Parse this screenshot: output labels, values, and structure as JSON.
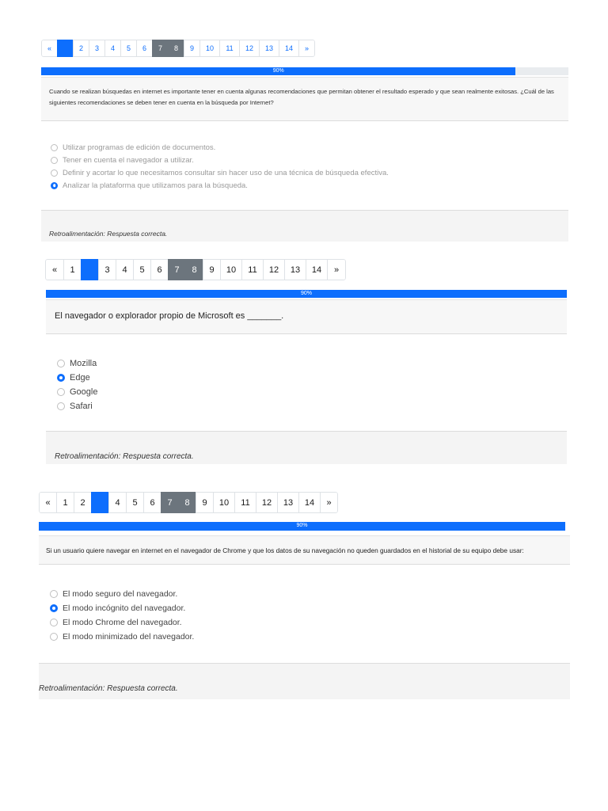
{
  "colors": {
    "accent": "#0d6efd",
    "answered": "#6c757d"
  },
  "blocks": [
    {
      "pagination": [
        "«",
        "",
        "2",
        "3",
        "4",
        "5",
        "6",
        "7",
        "8",
        "9",
        "10",
        "11",
        "12",
        "13",
        "14",
        "»"
      ],
      "progress": {
        "label": "90%",
        "value": 90
      },
      "question": "Cuando se realizan búsquedas en internet es importante tener en cuenta algunas recomendaciones que permitan obtener el resultado esperado y que sean realmente exitosas. ¿Cuál de las siguientes recomendaciones se deben tener en cuenta en la búsqueda por Internet?",
      "options": [
        "Utilizar programas de edición de documentos.",
        "Tener en cuenta el navegador a utilizar.",
        "Definir y acortar lo que necesitamos consultar sin hacer uso de una técnica de búsqueda efectiva.",
        "Analizar la plataforma que utilizamos para la búsqueda."
      ],
      "selected_option": 4,
      "feedback": "Retroalimentación: Respuesta correcta."
    },
    {
      "pagination": [
        "«",
        "1",
        "",
        "3",
        "4",
        "5",
        "6",
        "7",
        "8",
        "9",
        "10",
        "11",
        "12",
        "13",
        "14",
        "»"
      ],
      "progress": {
        "label": "90%",
        "value": 100
      },
      "question": "El navegador o explorador propio de Microsoft es _______.",
      "options": [
        "Mozilla",
        "Edge",
        "Google",
        "Safari"
      ],
      "selected_option": 2,
      "feedback": "Retroalimentación: Respuesta correcta."
    },
    {
      "pagination": [
        "«",
        "1",
        "2",
        "",
        "4",
        "5",
        "6",
        "7",
        "8",
        "9",
        "10",
        "11",
        "12",
        "13",
        "14",
        "»"
      ],
      "progress": {
        "label": "90%",
        "value": 100
      },
      "question": "Si un usuario quiere navegar en internet en el navegador de Chrome y que los datos de su navegación no queden guardados en el historial de su equipo debe usar:",
      "options": [
        "El modo seguro del navegador.",
        "El modo incógnito del navegador.",
        "El modo Chrome del navegador.",
        "El modo minimizado del navegador."
      ],
      "selected_option": 2,
      "feedback": "Retroalimentación: Respuesta correcta."
    }
  ]
}
